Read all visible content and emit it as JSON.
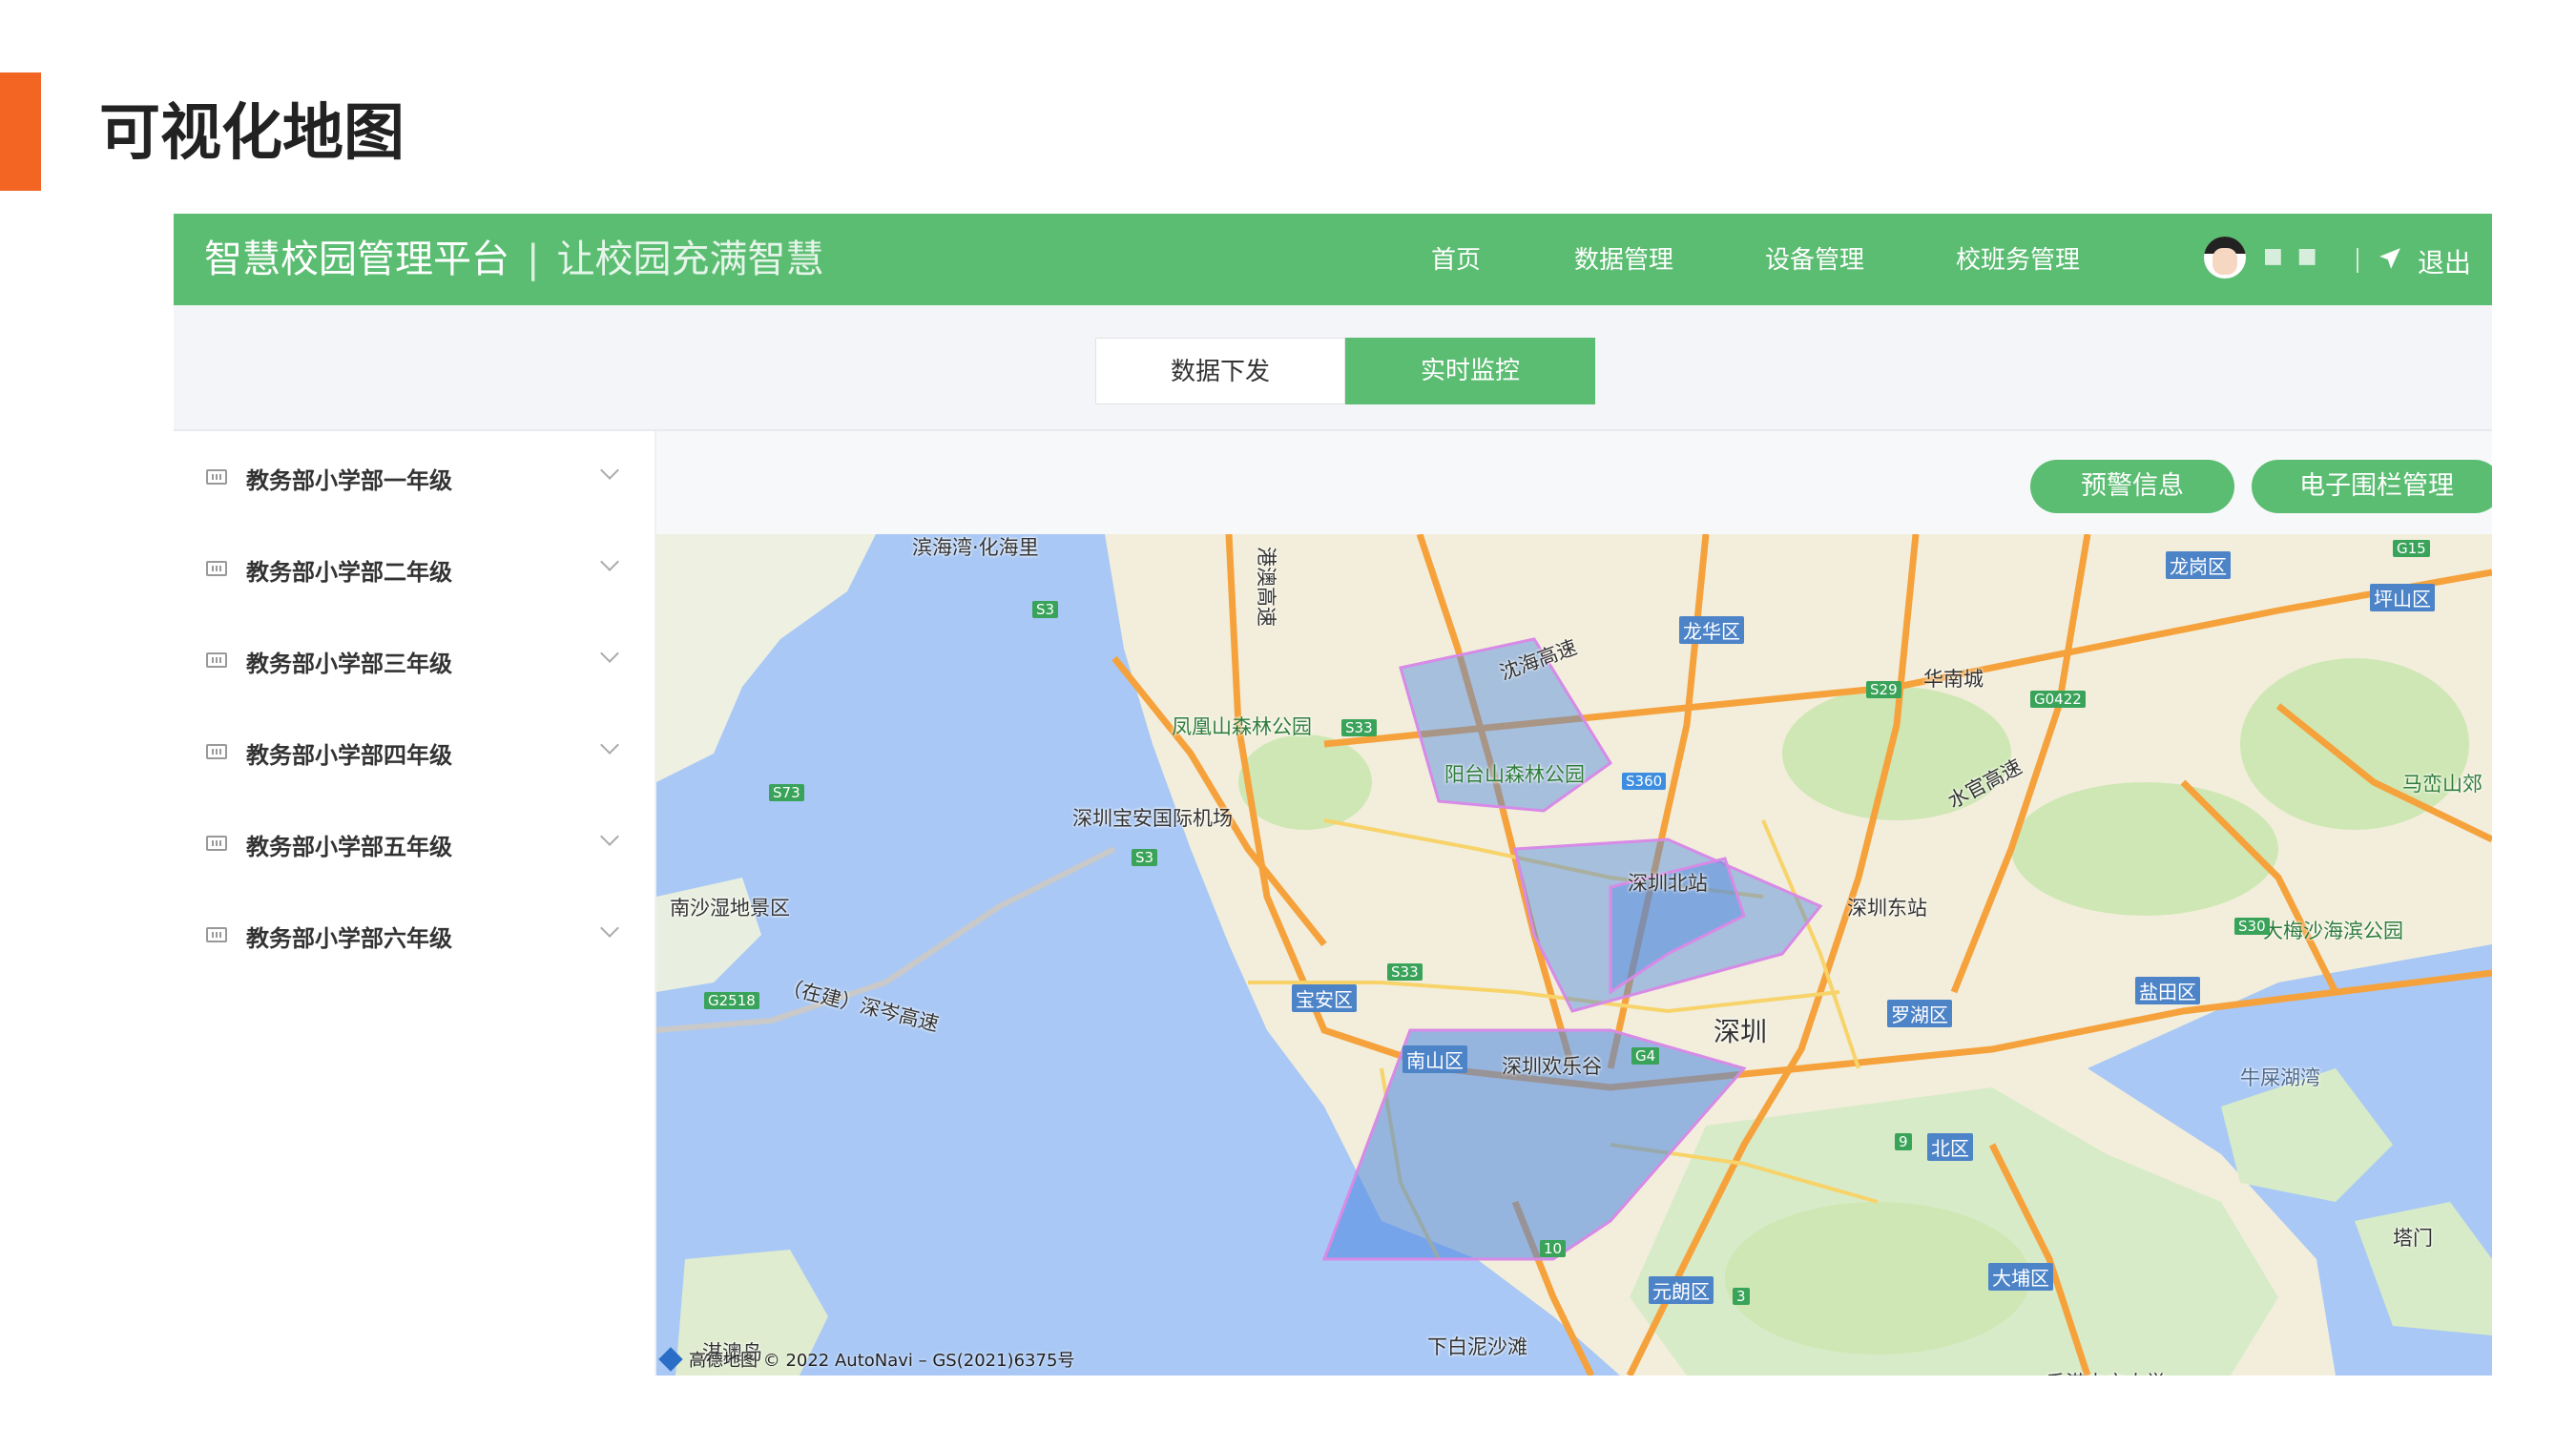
{
  "slide": {
    "title": "可视化地图",
    "accent_color": "#f26522"
  },
  "header": {
    "brand": "智慧校园管理平台",
    "separator": "|",
    "slogan": "让校园充满智慧",
    "nav": [
      "首页",
      "数据管理",
      "设备管理",
      "校班务管理"
    ],
    "username": "■ ■",
    "logout": "退出",
    "color": "#5bbd72"
  },
  "tabs": [
    {
      "label": "数据下发",
      "active": false
    },
    {
      "label": "实时监控",
      "active": true
    }
  ],
  "sidebar": {
    "items": [
      {
        "label": "教务部小学部一年级"
      },
      {
        "label": "教务部小学部二年级"
      },
      {
        "label": "教务部小学部三年级"
      },
      {
        "label": "教务部小学部四年级"
      },
      {
        "label": "教务部小学部五年级"
      },
      {
        "label": "教务部小学部六年级"
      }
    ]
  },
  "actions": {
    "warning": "预警信息",
    "fence": "电子围栏管理"
  },
  "map": {
    "places": {
      "binhaiwan": "滨海湾·化海里",
      "fenghuangshan": "凤凰山森林公园",
      "yangtaishan": "阳台山森林公园",
      "airport": "深圳宝安国际机场",
      "nanshashidi": "南沙湿地景区",
      "shenzhenbei": "深圳北站",
      "shenzhendong": "深圳东站",
      "shenzhen": "深圳",
      "happyvalley": "深圳欢乐谷",
      "huanancheng": "华南城",
      "masanshan": "马峦山郊",
      "dameisha": "大梅沙海滨公园",
      "niuweihai": "牛屎湖湾",
      "xiabaini": "下白泥沙滩",
      "qiaoao": "淇澳岛",
      "cuhk": "香港中文大学",
      "tamen": "塔门",
      "shenzhenhai_bridge": "（在建）深岑高速",
      "ganghaoqiao": "港澳高速",
      "yanhai": "沈海高速",
      "shuiguan": "水官高速"
    },
    "districts": {
      "longgang": "龙岗区",
      "pingshan": "坪山区",
      "longhua": "龙华区",
      "baoan": "宝安区",
      "nanshan": "南山区",
      "luohu": "罗湖区",
      "yantian": "盐田区",
      "beiqu": "北区",
      "yuanlang": "元朗区",
      "dapu": "大埔区"
    },
    "shields": [
      "S3",
      "S73",
      "S33",
      "G15",
      "S29",
      "G0422",
      "S360",
      "S3",
      "S33",
      "S30",
      "G2518",
      "G4",
      "9",
      "10",
      "3"
    ],
    "attribution": "高德地图 © 2022 AutoNavi – GS(2021)6375号",
    "fence_color": "#4a86e0"
  }
}
